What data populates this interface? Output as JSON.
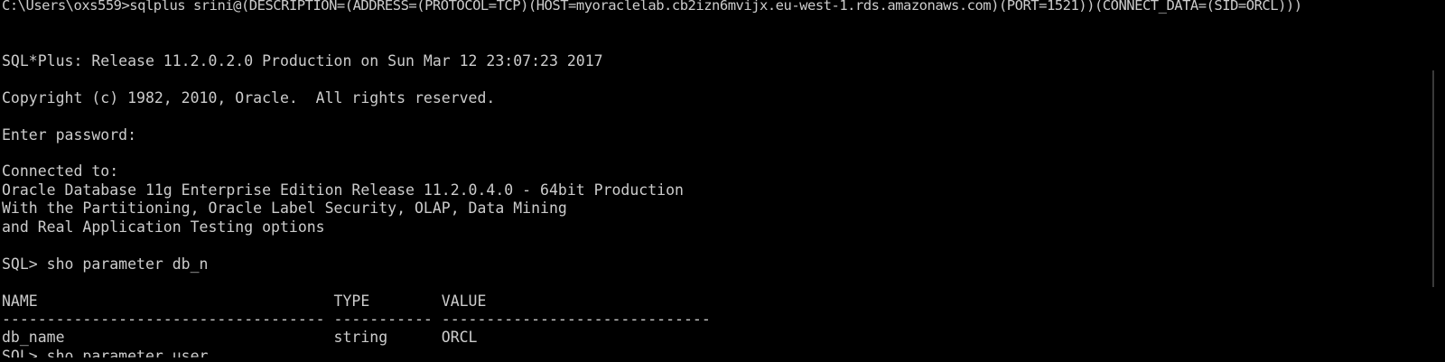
{
  "terminal": {
    "lines": [
      "C:\\Users\\oxs559>sqlplus srini@(DESCRIPTION=(ADDRESS=(PROTOCOL=TCP)(HOST=myoraclelab.cb2izn6mvijx.eu-west-1.rds.amazonaws.com)(PORT=1521))(CONNECT_DATA=(SID=ORCL)))",
      "",
      "",
      "SQL*Plus: Release 11.2.0.2.0 Production on Sun Mar 12 23:07:23 2017",
      "",
      "Copyright (c) 1982, 2010, Oracle.  All rights reserved.",
      "",
      "Enter password:",
      "",
      "Connected to:",
      "Oracle Database 11g Enterprise Edition Release 11.2.0.4.0 - 64bit Production",
      "With the Partitioning, Oracle Label Security, OLAP, Data Mining",
      "and Real Application Testing options",
      "",
      "SQL> sho parameter db_n",
      "",
      "NAME                                 TYPE        VALUE",
      "------------------------------------ ----------- ------------------------------",
      "db_name                              string      ORCL",
      "SQL> sho parameter user"
    ]
  },
  "colors": {
    "background": "#000000",
    "text": "#cccccc"
  }
}
